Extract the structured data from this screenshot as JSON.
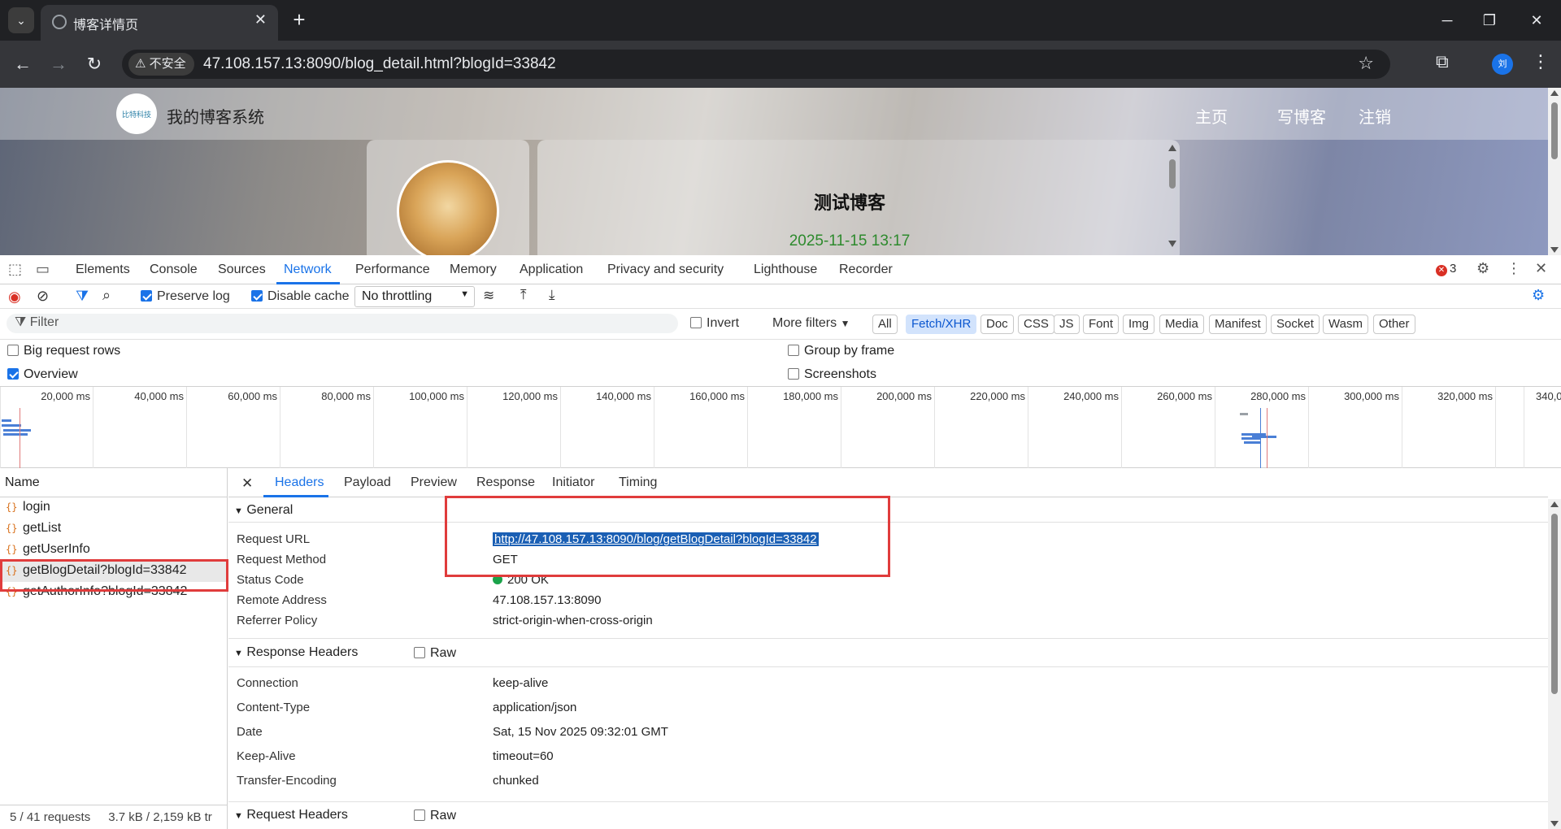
{
  "browser": {
    "tab_title": "博客详情页",
    "security_label": "不安全",
    "url": "47.108.157.13:8090/blog_detail.html?blogId=33842",
    "profile_initial": "刘"
  },
  "page": {
    "site_title": "我的博客系统",
    "logo_text": "比特科技",
    "nav": [
      "主页",
      "写博客",
      "注销"
    ],
    "blog_title": "测试博客",
    "blog_date": "2025-11-15 13:17"
  },
  "devtools": {
    "tabs": [
      "Elements",
      "Console",
      "Sources",
      "Network",
      "Performance",
      "Memory",
      "Application",
      "Privacy and security",
      "Lighthouse",
      "Recorder"
    ],
    "active_tab": "Network",
    "error_count": "3",
    "preserve_log": "Preserve log",
    "disable_cache": "Disable cache",
    "throttling": "No throttling",
    "filter_placeholder": "Filter",
    "invert": "Invert",
    "more_filters": "More filters",
    "filter_types": [
      "All",
      "Fetch/XHR",
      "Doc",
      "CSS",
      "JS",
      "Font",
      "Img",
      "Media",
      "Manifest",
      "Socket",
      "Wasm",
      "Other"
    ],
    "active_filter": "Fetch/XHR",
    "options": {
      "big_request_rows": "Big request rows",
      "overview": "Overview",
      "group_by_frame": "Group by frame",
      "screenshots": "Screenshots"
    },
    "overview_ticks": [
      "20,000 ms",
      "40,000 ms",
      "60,000 ms",
      "80,000 ms",
      "100,000 ms",
      "120,000 ms",
      "140,000 ms",
      "160,000 ms",
      "180,000 ms",
      "200,000 ms",
      "220,000 ms",
      "240,000 ms",
      "260,000 ms",
      "280,000 ms",
      "300,000 ms",
      "320,000 ms",
      "340,0"
    ],
    "requests_header": "Name",
    "requests": [
      "login",
      "getList",
      "getUserInfo",
      "getBlogDetail?blogId=33842",
      "getAuthorInfo?blogId=33842"
    ],
    "selected_request": "getBlogDetail?blogId=33842",
    "footer": "5 / 41 requests",
    "footer_size": "3.7 kB / 2,159 kB tr",
    "detail_tabs": [
      "Headers",
      "Payload",
      "Preview",
      "Response",
      "Initiator",
      "Timing"
    ],
    "general_title": "General",
    "general": [
      {
        "k": "Request URL",
        "v": "http://47.108.157.13:8090/blog/getBlogDetail?blogId=33842"
      },
      {
        "k": "Request Method",
        "v": "GET"
      },
      {
        "k": "Status Code",
        "v": "200 OK"
      },
      {
        "k": "Remote Address",
        "v": "47.108.157.13:8090"
      },
      {
        "k": "Referrer Policy",
        "v": "strict-origin-when-cross-origin"
      }
    ],
    "response_headers_title": "Response Headers",
    "raw_label": "Raw",
    "response_headers": [
      {
        "k": "Connection",
        "v": "keep-alive"
      },
      {
        "k": "Content-Type",
        "v": "application/json"
      },
      {
        "k": "Date",
        "v": "Sat, 15 Nov 2025 09:32:01 GMT"
      },
      {
        "k": "Keep-Alive",
        "v": "timeout=60"
      },
      {
        "k": "Transfer-Encoding",
        "v": "chunked"
      }
    ],
    "request_headers_title": "Request Headers"
  }
}
